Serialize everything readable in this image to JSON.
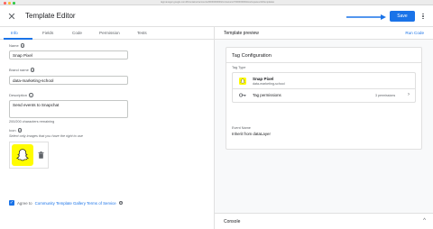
{
  "browser": {
    "url": "tagmanager.google.com/#/container/accounts/6000000000/containers/7000000000/workspaces/10/templates/new"
  },
  "header": {
    "title": "Template Editor",
    "save_label": "Save",
    "close_icon": "close-icon",
    "more_icon": "more-vert-icon"
  },
  "tabs": [
    {
      "label": "Info",
      "active": true
    },
    {
      "label": "Fields",
      "active": false
    },
    {
      "label": "Code",
      "active": false
    },
    {
      "label": "Permission",
      "active": false
    },
    {
      "label": "Tests",
      "active": false
    }
  ],
  "form": {
    "name": {
      "label": "Name",
      "value": "Snap Pixel"
    },
    "brand": {
      "label": "Brand name",
      "value": "data-marketing-school"
    },
    "description": {
      "label": "Description",
      "value": "Send events to Snapchat",
      "counter": "200/200 characters remaining"
    },
    "icon": {
      "label": "Icon",
      "hint": "Select only images that you have the right to use"
    },
    "agree": {
      "prefix": "Agree to",
      "link": "Community Template Gallery Terms of Service",
      "checked": true
    }
  },
  "preview": {
    "title": "Template preview",
    "run_code": "Run Code",
    "card_title": "Tag Configuration",
    "tag_type_label": "Tag Type",
    "tag_name": "Snap Pixel",
    "tag_brand": "data-marketing-school",
    "permissions_label": "Tag permissions",
    "permissions_count": "3 permissions",
    "event_label": "Event Name",
    "event_value": "Inherit from dataLayer"
  },
  "console": {
    "label": "Console"
  },
  "colors": {
    "accent": "#1a73e8",
    "snap_yellow": "#fffc00"
  }
}
